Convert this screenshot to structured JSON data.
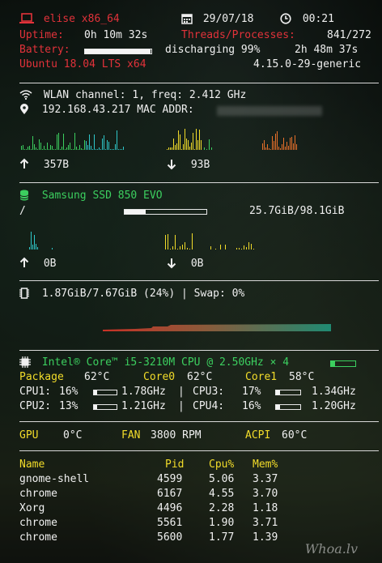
{
  "header": {
    "host": "elise x86_64",
    "date": "29/07/18",
    "time": "00:21",
    "uptime_label": "Uptime:",
    "uptime_value": "0h 10m 32s",
    "threads_label": "Threads/Processes:",
    "threads_value": "841/272",
    "battery_label": "Battery:",
    "battery_status": "discharging 99%",
    "battery_time": "2h 48m 37s",
    "battery_level": 0.99,
    "os": "Ubuntu 18.04 LTS x64",
    "kernel": "4.15.0-29-generic"
  },
  "network": {
    "iface_line": "WLAN  channel: 1, freq: 2.412 GHz",
    "ip_line": "192.168.43.217 MAC ADDR:",
    "up_value": "357B",
    "down_value": "93B"
  },
  "disk": {
    "name": "Samsung SSD 850 EVO",
    "mount": "/",
    "usage": "25.7GiB/98.1GiB",
    "used_fraction": 0.26,
    "read_value": "0B",
    "write_value": "0B"
  },
  "memory": {
    "line": "1.87GiB/7.67GiB (24%) | Swap: 0%",
    "used_fraction": 0.24
  },
  "cpu": {
    "name": "Intel® Core™ i5-3210M CPU @ 2.50GHz × 4",
    "load_fraction": 0.15,
    "package_label": "Package",
    "package_temp": "62°C",
    "core0_label": "Core0",
    "core0_temp": "62°C",
    "core1_label": "Core1",
    "core1_temp": "58°C",
    "cores": [
      {
        "label": "CPU1:",
        "pct": "16%",
        "freq": "1.78GHz",
        "load": 0.16
      },
      {
        "label": "CPU2:",
        "pct": "13%",
        "freq": "1.21GHz",
        "load": 0.13
      },
      {
        "label": "CPU3:",
        "pct": "17%",
        "freq": "1.34GHz",
        "load": 0.17
      },
      {
        "label": "CPU4:",
        "pct": "16%",
        "freq": "1.20GHz",
        "load": 0.16
      }
    ],
    "sep": "|"
  },
  "sensors": {
    "gpu_label": "GPU",
    "gpu_value": "0°C",
    "fan_label": "FAN",
    "fan_value": "3800 RPM",
    "acpi_label": "ACPI",
    "acpi_value": "60°C"
  },
  "processes": {
    "headers": [
      "Name",
      "Pid",
      "Cpu%",
      "Mem%"
    ],
    "rows": [
      [
        "gnome-shell",
        "4599",
        "5.06",
        "3.37"
      ],
      [
        "chrome",
        "6167",
        "4.55",
        "3.70"
      ],
      [
        "Xorg",
        "4496",
        "2.28",
        "1.18"
      ],
      [
        "chrome",
        "5561",
        "1.90",
        "3.71"
      ],
      [
        "chrome",
        "5600",
        "1.77",
        "1.39"
      ]
    ]
  },
  "watermark": "Whoa.lv",
  "colors": {
    "red": "#e2323a",
    "green": "#3ccf5f",
    "yellow": "#f2dc2a",
    "cyan": "#2fc7c9",
    "orange": "#e8702a"
  },
  "icons": [
    "laptop-icon",
    "calendar-icon",
    "clock-icon",
    "wifi-icon",
    "location-pin-icon",
    "arrow-up-icon",
    "arrow-down-icon",
    "database-icon",
    "memory-chip-icon",
    "cpu-chip-icon"
  ]
}
